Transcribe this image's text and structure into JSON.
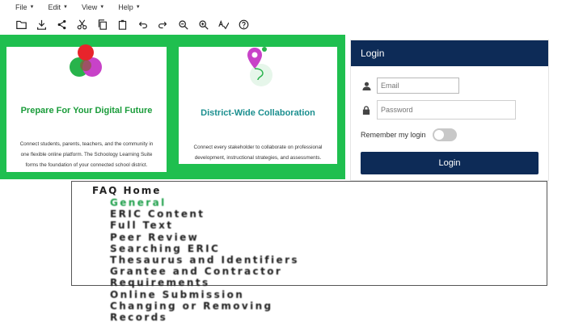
{
  "menubar": {
    "items": [
      "File",
      "Edit",
      "View",
      "Help"
    ]
  },
  "toolbar": {
    "icons": [
      "folder-icon",
      "download-icon",
      "share-icon",
      "cut-icon",
      "copy-icon",
      "paste-icon",
      "undo-icon",
      "redo-icon",
      "zoom-out-icon",
      "zoom-in-icon",
      "spell-check-icon",
      "help-icon"
    ]
  },
  "cards": [
    {
      "title": "Prepare For Your Digital Future",
      "desc": "Connect students, parents, teachers, and the community in one flexible online platform. The Schoology Learning Suite forms the foundation of your connected school district."
    },
    {
      "title": "District-Wide Collaboration",
      "desc": "Connect every stakeholder to collaborate on professional development, instructional strategies, and assessments."
    }
  ],
  "login": {
    "header": "Login",
    "email_placeholder": "Email",
    "password_placeholder": "Password",
    "remember_label": "Remember my login",
    "remember_on": false,
    "button_label": "Login"
  },
  "faq": {
    "heading": "FAQ Home",
    "items": [
      "General",
      "ERIC Content",
      "Full Text",
      "Peer Review",
      "Searching ERIC",
      "Thesaurus and Identifiers",
      "Grantee and Contractor",
      "Requirements",
      "Online Submission",
      "Changing or Removing",
      "Records"
    ],
    "active_index": 0
  },
  "colors": {
    "band_green": "#1fbf4f",
    "navy": "#0d2b57",
    "faq_active": "#1e9f4a"
  }
}
